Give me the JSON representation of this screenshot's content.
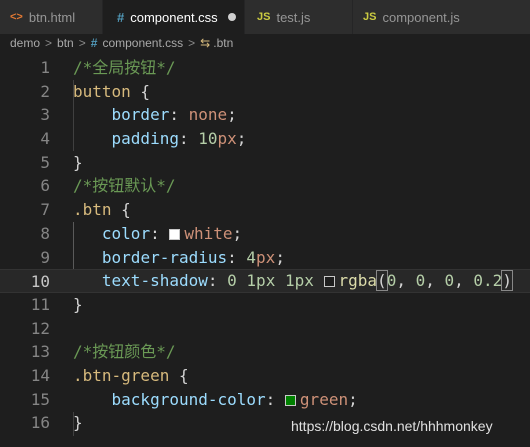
{
  "tabs": [
    {
      "icon": "<>",
      "label": "btn.html",
      "active": false
    },
    {
      "icon": "#",
      "label": "component.css",
      "active": true,
      "modified": true
    },
    {
      "icon": "JS",
      "label": "test.js",
      "active": false
    },
    {
      "icon": "JS",
      "label": "component.js",
      "active": false
    }
  ],
  "breadcrumb": {
    "items": [
      "demo",
      "btn",
      "component.css",
      ".btn"
    ],
    "separator": ">"
  },
  "editor": {
    "current_line": 10,
    "line_numbers": [
      "1",
      "2",
      "3",
      "4",
      "5",
      "6",
      "7",
      "8",
      "9",
      "10",
      "11",
      "12",
      "13",
      "14",
      "15",
      "16"
    ],
    "lines": {
      "l1": {
        "comment": "/*全局按钮*/"
      },
      "l2": {
        "selector": "button",
        "brace": " {"
      },
      "l3": {
        "indent": "    ",
        "prop": "border",
        "colon": ": ",
        "value": "none",
        "semi": ";"
      },
      "l4": {
        "indent": "    ",
        "prop": "padding",
        "colon": ": ",
        "num": "10",
        "unit": "px",
        "semi": ";"
      },
      "l5": {
        "brace": "}"
      },
      "l6": {
        "comment": "/*按钮默认*/"
      },
      "l7": {
        "selector": ".btn",
        "brace": " {"
      },
      "l8": {
        "indent": "   ",
        "prop": "color",
        "colon": ": ",
        "value": "white",
        "semi": ";",
        "swatch": "#ffffff"
      },
      "l9": {
        "indent": "   ",
        "prop": "border-radius",
        "colon": ": ",
        "num": "4",
        "unit": "px",
        "semi": ";"
      },
      "l10": {
        "indent": "   ",
        "prop": "text-shadow",
        "colon": ": ",
        "n1": "0",
        "n2": "1px",
        "n3": "1px",
        "func": "rgba",
        "paren_open": "(",
        "a1": "0",
        "a2": "0",
        "a3": "0",
        "a4": "0.2",
        "paren_close": ")",
        "comma": ", ",
        "swatch": "#1e1e1e"
      },
      "l11": {
        "brace": "}"
      },
      "l12": {
        "text": ""
      },
      "l13": {
        "comment": "/*按钮颜色*/"
      },
      "l14": {
        "selector": ".btn-green",
        "brace": " {"
      },
      "l15": {
        "indent": "    ",
        "prop": "background-color",
        "colon": ": ",
        "value": "green",
        "semi": ";",
        "swatch": "#008000"
      },
      "l16": {
        "brace": "}"
      }
    }
  },
  "watermark": "https://blog.csdn.net/hhhmonkey",
  "colors": {
    "editor_bg": "#1e1e1e",
    "comment": "#6a9955",
    "selector": "#d7ba7d",
    "property": "#9cdcfe",
    "value": "#ce9178",
    "number": "#b5cea8",
    "function": "#dcdcaa"
  }
}
